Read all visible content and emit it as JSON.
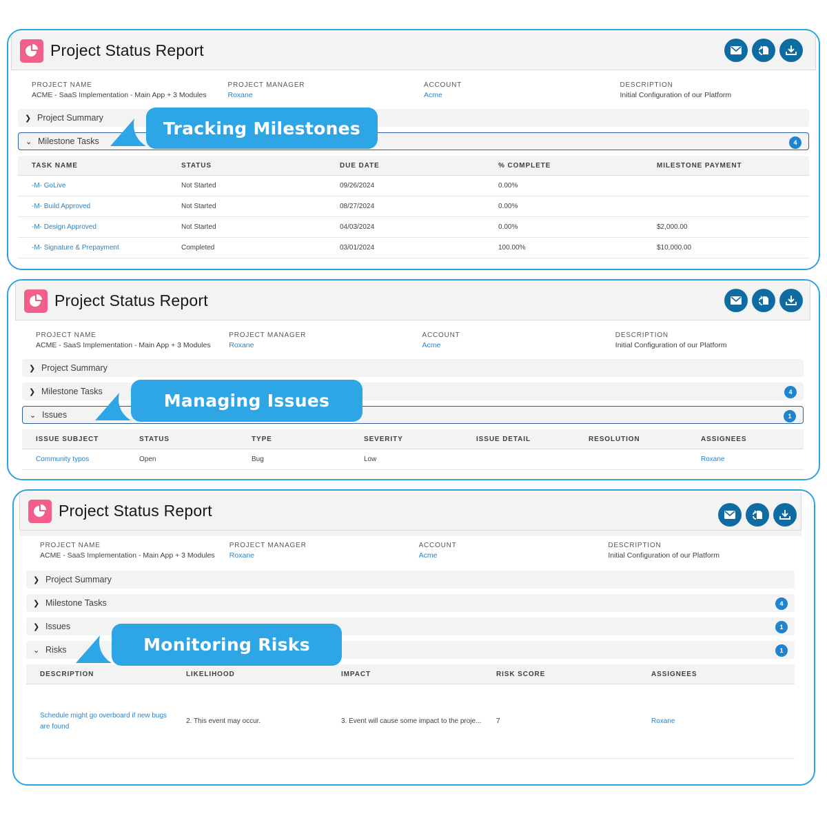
{
  "report": {
    "title": "Project Status Report",
    "actions": [
      {
        "name": "email",
        "icon": "envelope-icon"
      },
      {
        "name": "sync",
        "icon": "document-sync-icon"
      },
      {
        "name": "download",
        "icon": "download-icon"
      }
    ],
    "fields": [
      {
        "label": "PROJECT NAME",
        "value": "ACME - SaaS Implementation - Main App + 3 Modules",
        "link": false
      },
      {
        "label": "PROJECT MANAGER",
        "value": "Roxane",
        "link": true
      },
      {
        "label": "ACCOUNT",
        "value": "Acme",
        "link": true
      },
      {
        "label": "DESCRIPTION",
        "value": "Initial Configuration of our Platform",
        "link": false
      }
    ]
  },
  "sections": {
    "project_summary": "Project Summary",
    "milestone_tasks": "Milestone Tasks",
    "milestone_count": "4",
    "issues": "Issues",
    "issues_count": "1",
    "risks": "Risks",
    "risks_count": "1"
  },
  "callouts": {
    "milestones": "Tracking Milestones",
    "issues": "Managing Issues",
    "risks": "Monitoring Risks"
  },
  "milestone_table": {
    "headers": [
      "TASK NAME",
      "STATUS",
      "DUE DATE",
      "% COMPLETE",
      "MILESTONE PAYMENT"
    ],
    "rows": [
      [
        "-M- GoLive",
        "Not Started",
        "09/26/2024",
        "0.00%",
        ""
      ],
      [
        "-M- Build Approved",
        "Not Started",
        "08/27/2024",
        "0.00%",
        ""
      ],
      [
        "-M- Design Approved",
        "Not Started",
        "04/03/2024",
        "0.00%",
        "$2,000.00"
      ],
      [
        "-M- Signature & Prepayment",
        "Completed",
        "03/01/2024",
        "100.00%",
        "$10,000.00"
      ]
    ]
  },
  "issues_table": {
    "headers": [
      "ISSUE SUBJECT",
      "STATUS",
      "TYPE",
      "SEVERITY",
      "ISSUE DETAIL",
      "RESOLUTION",
      "ASSIGNEES"
    ],
    "rows": [
      [
        "Community typos",
        "Open",
        "Bug",
        "Low",
        "",
        "",
        "Roxane"
      ]
    ]
  },
  "risks_table": {
    "headers": [
      "DESCRIPTION",
      "LIKELIHOOD",
      "IMPACT",
      "RISK SCORE",
      "ASSIGNEES"
    ],
    "rows": [
      [
        "Schedule might go overboard if new bugs are found",
        "2. This event may occur.",
        "3. Event will cause some impact to the proje...",
        "7",
        "Roxane"
      ]
    ]
  },
  "colors": {
    "accent": "#2aa3e3",
    "action_button": "#0f6ca2",
    "badge": "#1f84cf",
    "logo": "#f25f8b",
    "link": "#2c82c9"
  }
}
